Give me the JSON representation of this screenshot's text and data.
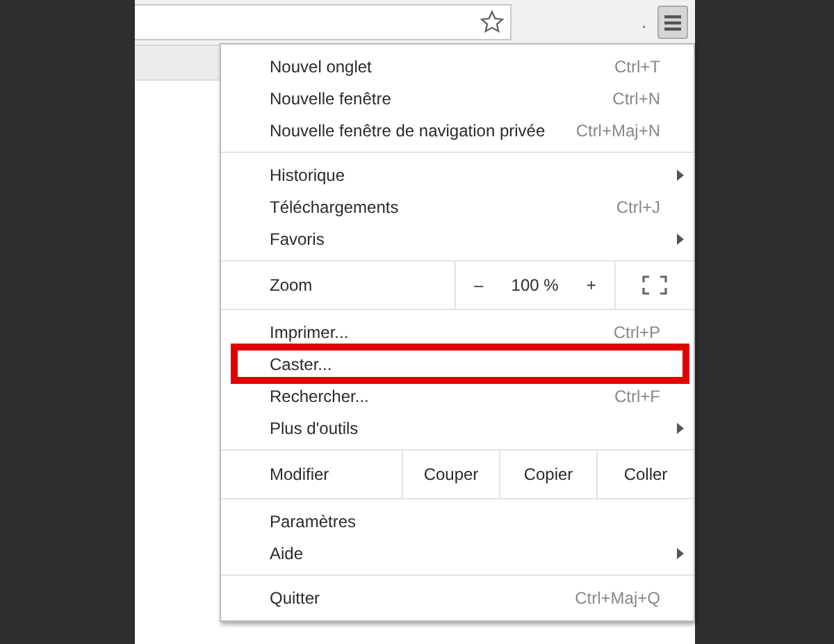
{
  "toolbar": {
    "dot": "."
  },
  "menu": {
    "sections": [
      {
        "items": [
          {
            "kind": "item",
            "label": "Nouvel onglet",
            "shortcut": "Ctrl+T",
            "submenu": false,
            "highlighted": false
          },
          {
            "kind": "item",
            "label": "Nouvelle fenêtre",
            "shortcut": "Ctrl+N",
            "submenu": false,
            "highlighted": false
          },
          {
            "kind": "item",
            "label": "Nouvelle fenêtre de navigation privée",
            "shortcut": "Ctrl+Maj+N",
            "submenu": false,
            "highlighted": false
          }
        ]
      },
      {
        "items": [
          {
            "kind": "item",
            "label": "Historique",
            "submenu": true,
            "highlighted": false
          },
          {
            "kind": "item",
            "label": "Téléchargements",
            "shortcut": "Ctrl+J",
            "submenu": false,
            "highlighted": false
          },
          {
            "kind": "item",
            "label": "Favoris",
            "submenu": true,
            "highlighted": false
          }
        ]
      },
      {
        "items": [
          {
            "kind": "zoom",
            "label": "Zoom",
            "minus": "–",
            "value": "100 %",
            "plus": "+"
          }
        ]
      },
      {
        "items": [
          {
            "kind": "item",
            "label": "Imprimer...",
            "shortcut": "Ctrl+P",
            "submenu": false,
            "highlighted": false
          },
          {
            "kind": "item",
            "label": "Caster...",
            "submenu": false,
            "highlighted": true
          },
          {
            "kind": "item",
            "label": "Rechercher...",
            "shortcut": "Ctrl+F",
            "submenu": false,
            "highlighted": false
          },
          {
            "kind": "item",
            "label": "Plus d'outils",
            "submenu": true,
            "highlighted": false
          }
        ]
      },
      {
        "items": [
          {
            "kind": "edit",
            "label": "Modifier",
            "buttons": [
              "Couper",
              "Copier",
              "Coller"
            ]
          }
        ]
      },
      {
        "items": [
          {
            "kind": "item",
            "label": "Paramètres",
            "submenu": false,
            "highlighted": false
          },
          {
            "kind": "item",
            "label": "Aide",
            "submenu": true,
            "highlighted": false
          }
        ]
      },
      {
        "items": [
          {
            "kind": "item",
            "label": "Quitter",
            "shortcut": "Ctrl+Maj+Q",
            "submenu": false,
            "highlighted": false
          }
        ]
      }
    ]
  }
}
